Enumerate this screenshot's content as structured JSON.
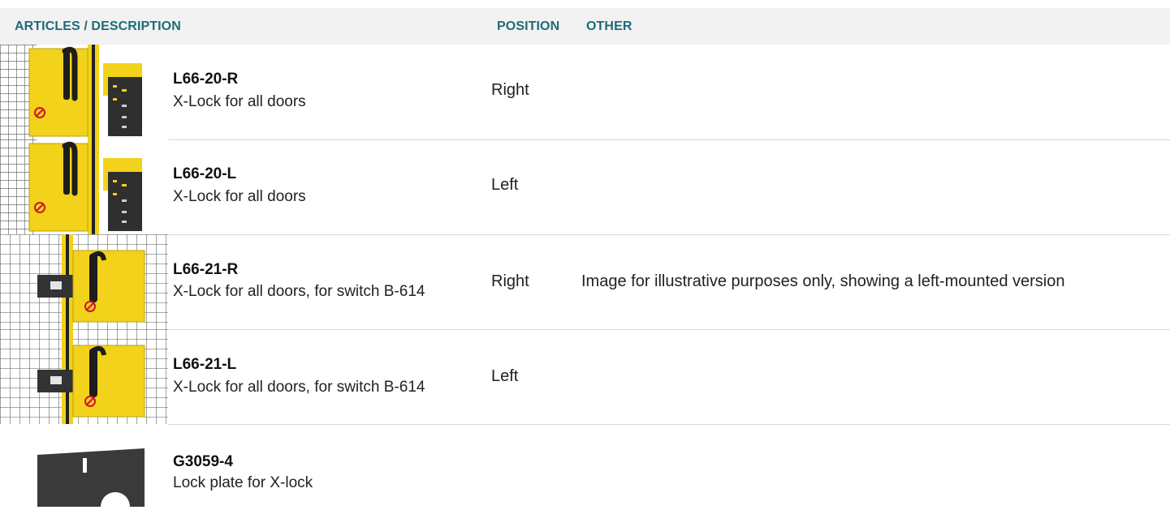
{
  "header": {
    "articles": "ARTICLES / DESCRIPTION",
    "position": "POSITION",
    "other": "OTHER"
  },
  "colors": {
    "header_text": "#1f6b78",
    "header_bg": "#f2f2f2",
    "lock_yellow": "#f2d21a",
    "plate_dark": "#3a3a3a"
  },
  "rows": [
    {
      "code": "L66-20-R",
      "description": "X-Lock for all doors",
      "position": "Right",
      "other": "",
      "image": "x-lock-image"
    },
    {
      "code": "L66-20-L",
      "description": "X-Lock for all doors",
      "position": "Left",
      "other": "",
      "image": "x-lock-image"
    },
    {
      "code": "L66-21-R",
      "description": "X-Lock for all doors, for switch B-614",
      "position": "Right",
      "other": "Image for illustrative purposes only, showing a left-mounted version",
      "image": "x-lock-switch-image"
    },
    {
      "code": "L66-21-L",
      "description": "X-Lock for all doors, for switch B-614",
      "position": "Left",
      "other": "",
      "image": "x-lock-switch-image"
    },
    {
      "code": "G3059-4",
      "description": "Lock plate for X-lock",
      "position": "",
      "other": "",
      "image": "lock-plate-image"
    }
  ]
}
